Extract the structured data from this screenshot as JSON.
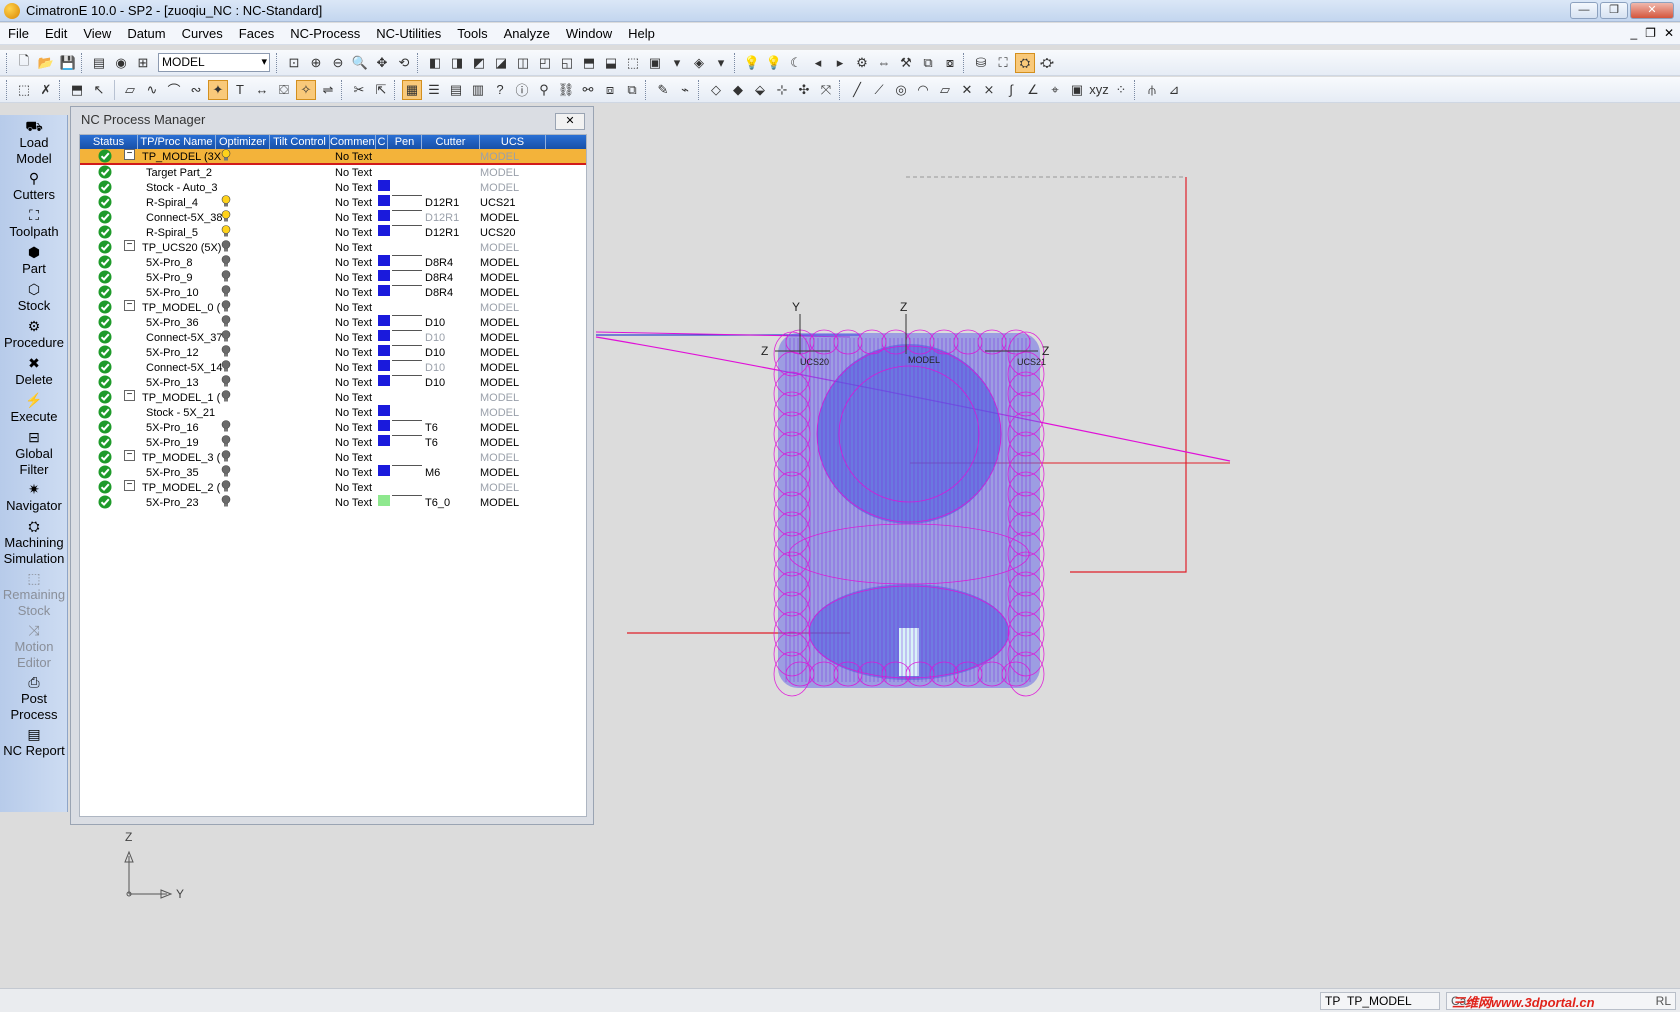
{
  "window": {
    "title": "CimatronE 10.0 - SP2 - [zuoqiu_NC : NC-Standard]"
  },
  "menu": [
    "File",
    "Edit",
    "View",
    "Datum",
    "Curves",
    "Faces",
    "NC-Process",
    "NC-Utilities",
    "Tools",
    "Analyze",
    "Window",
    "Help"
  ],
  "toolbar": {
    "model_select": "MODEL"
  },
  "sidebar": [
    {
      "label": "Load\nModel",
      "icon": "load-model-icon",
      "enabled": true
    },
    {
      "label": "Cutters",
      "icon": "cutter-icon",
      "enabled": true
    },
    {
      "label": "Toolpath",
      "icon": "toolpath-icon",
      "enabled": true
    },
    {
      "label": "Part",
      "icon": "part-icon",
      "enabled": true
    },
    {
      "label": "Stock",
      "icon": "stock-icon",
      "enabled": true
    },
    {
      "label": "Procedure",
      "icon": "procedure-icon",
      "enabled": true
    },
    {
      "label": "Delete",
      "icon": "delete-icon",
      "enabled": true
    },
    {
      "label": "Execute",
      "icon": "execute-icon",
      "enabled": true
    },
    {
      "label": "Global\nFilter",
      "icon": "filter-icon",
      "enabled": true
    },
    {
      "label": "Navigator",
      "icon": "navigator-icon",
      "enabled": true
    },
    {
      "label": "Machining\nSimulation",
      "icon": "simulation-icon",
      "enabled": true
    },
    {
      "label": "Remaining\nStock",
      "icon": "remaining-stock-icon",
      "enabled": false
    },
    {
      "label": "Motion\nEditor",
      "icon": "motion-editor-icon",
      "enabled": false
    },
    {
      "label": "Post\nProcess",
      "icon": "post-process-icon",
      "enabled": true
    },
    {
      "label": "NC Report",
      "icon": "report-icon",
      "enabled": true
    }
  ],
  "nc_manager": {
    "title": "NC Process Manager",
    "columns": [
      "Status",
      "TP/Proc Name",
      "Optimizer",
      "Tilt Control",
      "Comment",
      "C",
      "Pen",
      "Cutter",
      "UCS"
    ],
    "rows": [
      {
        "name": "TP_MODEL (3X",
        "expander": "−",
        "bulb": "yellow",
        "comment": "No Text",
        "pen": "",
        "cutter": "",
        "ucs": "MODEL",
        "ucs_gray": true,
        "selected": true
      },
      {
        "name": "Target Part_2",
        "expander": "",
        "bulb": "",
        "comment": "No Text",
        "pen": "",
        "cutter": "",
        "ucs": "MODEL",
        "ucs_gray": true
      },
      {
        "name": "Stock - Auto_3",
        "expander": "",
        "bulb": "",
        "comment": "No Text",
        "pen": "#1a1adc",
        "cutter": "",
        "ucs": "MODEL",
        "ucs_gray": true
      },
      {
        "name": "R-Spiral_4",
        "expander": "",
        "bulb": "yellow",
        "comment": "No Text",
        "pen": "#1a1adc",
        "cutter": "D12R1",
        "ucs": "UCS21"
      },
      {
        "name": "Connect-5X_38",
        "expander": "",
        "bulb": "yellow",
        "comment": "No Text",
        "pen": "#1a1adc",
        "cutter": "D12R1",
        "cutter_gray": true,
        "ucs": "MODEL"
      },
      {
        "name": "R-Spiral_5",
        "expander": "",
        "bulb": "yellow",
        "comment": "No Text",
        "pen": "#1a1adc",
        "cutter": "D12R1",
        "ucs": "UCS20"
      },
      {
        "name": "TP_UCS20 (5X)",
        "expander": "−",
        "bulb": "gray",
        "comment": "No Text",
        "pen": "",
        "cutter": "",
        "ucs": "MODEL",
        "ucs_gray": true
      },
      {
        "name": "5X-Pro_8",
        "expander": "",
        "bulb": "gray",
        "comment": "No Text",
        "pen": "#1a1adc",
        "cutter": "D8R4",
        "ucs": "MODEL"
      },
      {
        "name": "5X-Pro_9",
        "expander": "",
        "bulb": "gray",
        "comment": "No Text",
        "pen": "#1a1adc",
        "cutter": "D8R4",
        "ucs": "MODEL"
      },
      {
        "name": "5X-Pro_10",
        "expander": "",
        "bulb": "gray",
        "comment": "No Text",
        "pen": "#1a1adc",
        "cutter": "D8R4",
        "ucs": "MODEL"
      },
      {
        "name": "TP_MODEL_0 (",
        "expander": "−",
        "bulb": "gray",
        "comment": "No Text",
        "pen": "",
        "cutter": "",
        "ucs": "MODEL",
        "ucs_gray": true
      },
      {
        "name": "5X-Pro_36",
        "expander": "",
        "bulb": "gray",
        "comment": "No Text",
        "pen": "#1a1adc",
        "cutter": "D10",
        "ucs": "MODEL"
      },
      {
        "name": "Connect-5X_37",
        "expander": "",
        "bulb": "gray",
        "comment": "No Text",
        "pen": "#1a1adc",
        "cutter": "D10",
        "cutter_gray": true,
        "ucs": "MODEL"
      },
      {
        "name": "5X-Pro_12",
        "expander": "",
        "bulb": "gray",
        "comment": "No Text",
        "pen": "#1a1adc",
        "cutter": "D10",
        "ucs": "MODEL"
      },
      {
        "name": "Connect-5X_14",
        "expander": "",
        "bulb": "gray",
        "comment": "No Text",
        "pen": "#1a1adc",
        "cutter": "D10",
        "cutter_gray": true,
        "ucs": "MODEL"
      },
      {
        "name": "5X-Pro_13",
        "expander": "",
        "bulb": "gray",
        "comment": "No Text",
        "pen": "#1a1adc",
        "cutter": "D10",
        "ucs": "MODEL"
      },
      {
        "name": "TP_MODEL_1 (",
        "expander": "−",
        "bulb": "gray",
        "comment": "No Text",
        "pen": "",
        "cutter": "",
        "ucs": "MODEL",
        "ucs_gray": true
      },
      {
        "name": "Stock - 5X_21",
        "expander": "",
        "bulb": "",
        "comment": "No Text",
        "pen": "#1a1adc",
        "cutter": "",
        "ucs": "MODEL",
        "ucs_gray": true
      },
      {
        "name": "5X-Pro_16",
        "expander": "",
        "bulb": "gray",
        "comment": "No Text",
        "pen": "#1a1adc",
        "cutter": "T6",
        "ucs": "MODEL"
      },
      {
        "name": "5X-Pro_19",
        "expander": "",
        "bulb": "gray",
        "comment": "No Text",
        "pen": "#1a1adc",
        "cutter": "T6",
        "ucs": "MODEL"
      },
      {
        "name": "TP_MODEL_3 (",
        "expander": "−",
        "bulb": "gray",
        "comment": "No Text",
        "pen": "",
        "cutter": "",
        "ucs": "MODEL",
        "ucs_gray": true
      },
      {
        "name": "5X-Pro_35",
        "expander": "",
        "bulb": "gray",
        "comment": "No Text",
        "pen": "#1a1adc",
        "cutter": "M6",
        "ucs": "MODEL"
      },
      {
        "name": "TP_MODEL_2 (",
        "expander": "−",
        "bulb": "gray",
        "comment": "No Text",
        "pen": "",
        "cutter": "",
        "ucs": "MODEL",
        "ucs_gray": true
      },
      {
        "name": "5X-Pro_23",
        "expander": "",
        "bulb": "gray",
        "comment": "No Text",
        "pen": "#8ee88e",
        "cutter": "T6_0",
        "ucs": "MODEL"
      }
    ]
  },
  "viewport": {
    "triad": {
      "z": "Z",
      "y": "Y"
    },
    "ucs_labels": {
      "y_axis": "Y",
      "z_axis": "Z",
      "left_z": "Z",
      "right_z": "Z",
      "ucs20": "UCS20",
      "ucs21": "UCS21",
      "model": "MODEL"
    }
  },
  "statusbar": {
    "tp": "TP",
    "tp_value": "TP_MODEL",
    "partial": "Ca",
    "rl": "RL"
  },
  "watermark": "三维网www.3dportal.cn",
  "colors": {
    "toolpath_magenta": "#e010d8",
    "toolpath_blue": "#3a4fd8",
    "selection": "#f3b33a",
    "header_blue": "#1f5ec2"
  }
}
